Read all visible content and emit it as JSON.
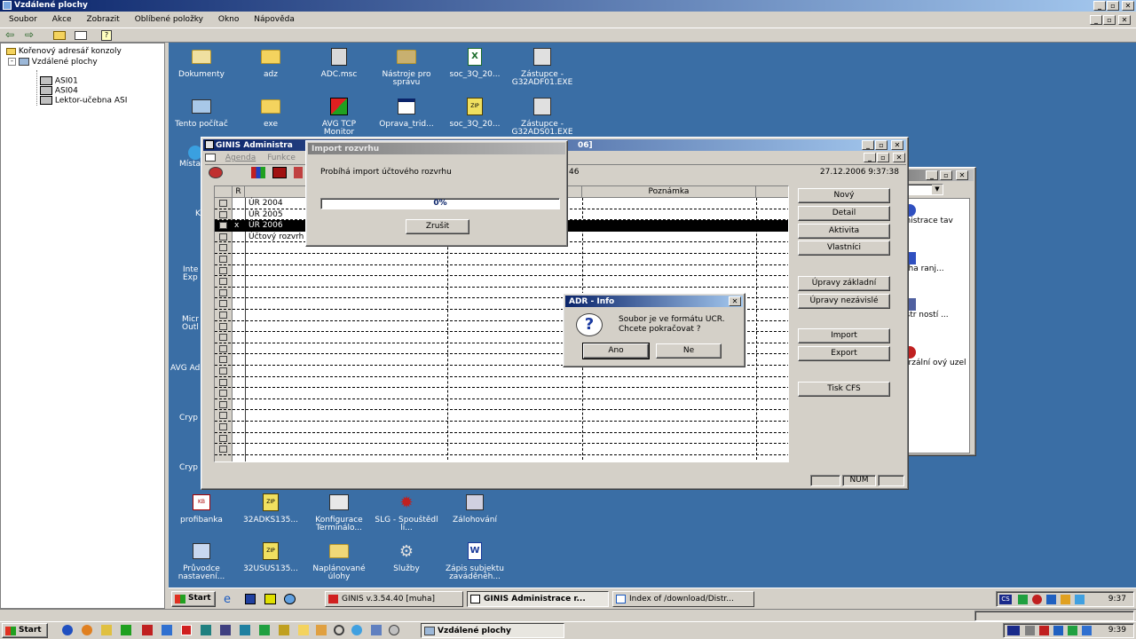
{
  "outer_window": {
    "title": "Vzdálené plochy",
    "menu": [
      "Soubor",
      "Akce",
      "Zobrazit",
      "Oblíbené položky",
      "Okno",
      "Nápověda"
    ]
  },
  "tree": {
    "root": "Kořenový adresář konzoly",
    "node": "Vzdálené plochy",
    "children": [
      "ASI01",
      "ASI04",
      "Lektor-učebna ASI"
    ]
  },
  "desktop_icons": [
    {
      "label": "Dokumenty",
      "icon": "documents-folder-icon"
    },
    {
      "label": "adz",
      "icon": "folder-icon"
    },
    {
      "label": "ADC.msc",
      "icon": "console-icon"
    },
    {
      "label": "Nástroje pro správu",
      "icon": "admin-tools-icon"
    },
    {
      "label": "soc_3Q_20...",
      "icon": "excel-file-icon"
    },
    {
      "label": "Zástupce - G32ADF01.EXE",
      "icon": "installer-icon"
    },
    {
      "label": "Tento počítač",
      "icon": "computer-icon"
    },
    {
      "label": "exe",
      "icon": "folder-icon"
    },
    {
      "label": "AVG TCP Monitor",
      "icon": "avg-icon"
    },
    {
      "label": "Oprava_trid...",
      "icon": "app-window-icon"
    },
    {
      "label": "soc_3Q_20...",
      "icon": "zip-file-icon"
    },
    {
      "label": "Zástupce - G32ADS01.EXE",
      "icon": "installer-icon"
    },
    {
      "label": "profibanka",
      "icon": "bank-icon"
    },
    {
      "label": "32ADKS135...",
      "icon": "zip-file-icon"
    },
    {
      "label": "Konfigurace Terminálo...",
      "icon": "terminal-config-icon"
    },
    {
      "label": "SLG - Spouštědl li...",
      "icon": "gear-icon"
    },
    {
      "label": "Zálohování",
      "icon": "backup-icon"
    },
    {
      "label": "Průvodce nastavení...",
      "icon": "wizard-icon"
    },
    {
      "label": "32USUS135...",
      "icon": "zip-file-icon"
    },
    {
      "label": "Naplánované úlohy",
      "icon": "scheduled-tasks-icon"
    },
    {
      "label": "Služby",
      "icon": "services-icon"
    },
    {
      "label": "Zápis subjektu zaváděnéh...",
      "icon": "word-file-icon"
    }
  ],
  "left_partial_labels": [
    "Místa",
    "K",
    "Inte Exp",
    "Micr Outl",
    "AVG Ad",
    "Cryp",
    "Cryp"
  ],
  "right_partial_labels": [
    "inistrace tav",
    "aha ranj...",
    "istr ností ...",
    "erzální ový uzel"
  ],
  "ginis_window": {
    "title": "GINIS Administra",
    "title_suffix": "06]",
    "menu": [
      "Agenda",
      "Funkce"
    ],
    "datetime": "27.12.2006 9:37:38",
    "partial_time": "46",
    "columns": [
      "R",
      "Poznámka"
    ],
    "rows": [
      {
        "r": "",
        "name": "ÚR 2004"
      },
      {
        "r": "",
        "name": "ÚR 2005"
      },
      {
        "r": "x",
        "name": "ÚR 2006"
      },
      {
        "r": "",
        "name": "Účtový rozvrh"
      }
    ],
    "buttons": [
      "Nový",
      "Detail",
      "Aktivita",
      "Vlastníci",
      "Úpravy základní",
      "Úpravy nezávislé",
      "Import",
      "Export",
      "Tisk CFS"
    ],
    "status_num": "NUM"
  },
  "import_dialog": {
    "title": "Import rozvrhu",
    "message": "Probíhá import účtového rozvrhu",
    "progress_text": "0%",
    "progress": 0,
    "cancel_label": "Zrušit"
  },
  "info_dialog": {
    "title": "ADR - Info",
    "message_line1": "Soubor je ve formátu UCR.",
    "message_line2": "Chcete pokračovat ?",
    "yes_label": "Ano",
    "no_label": "Ne"
  },
  "inner_taskbar": {
    "start": "Start",
    "items": [
      "GINIS   v.3.54.40 [muha]",
      "GINIS Administrace r...",
      "Index of /download/Distr..."
    ],
    "tray_lang": "CS",
    "time": "9:37"
  },
  "outer_taskbar": {
    "start": "Start",
    "task": "Vzdálené plochy",
    "time": "9:39"
  },
  "colors": {
    "desktop": "#3a6ea5",
    "title_active": "#0a246a",
    "face": "#d4d0c8"
  }
}
